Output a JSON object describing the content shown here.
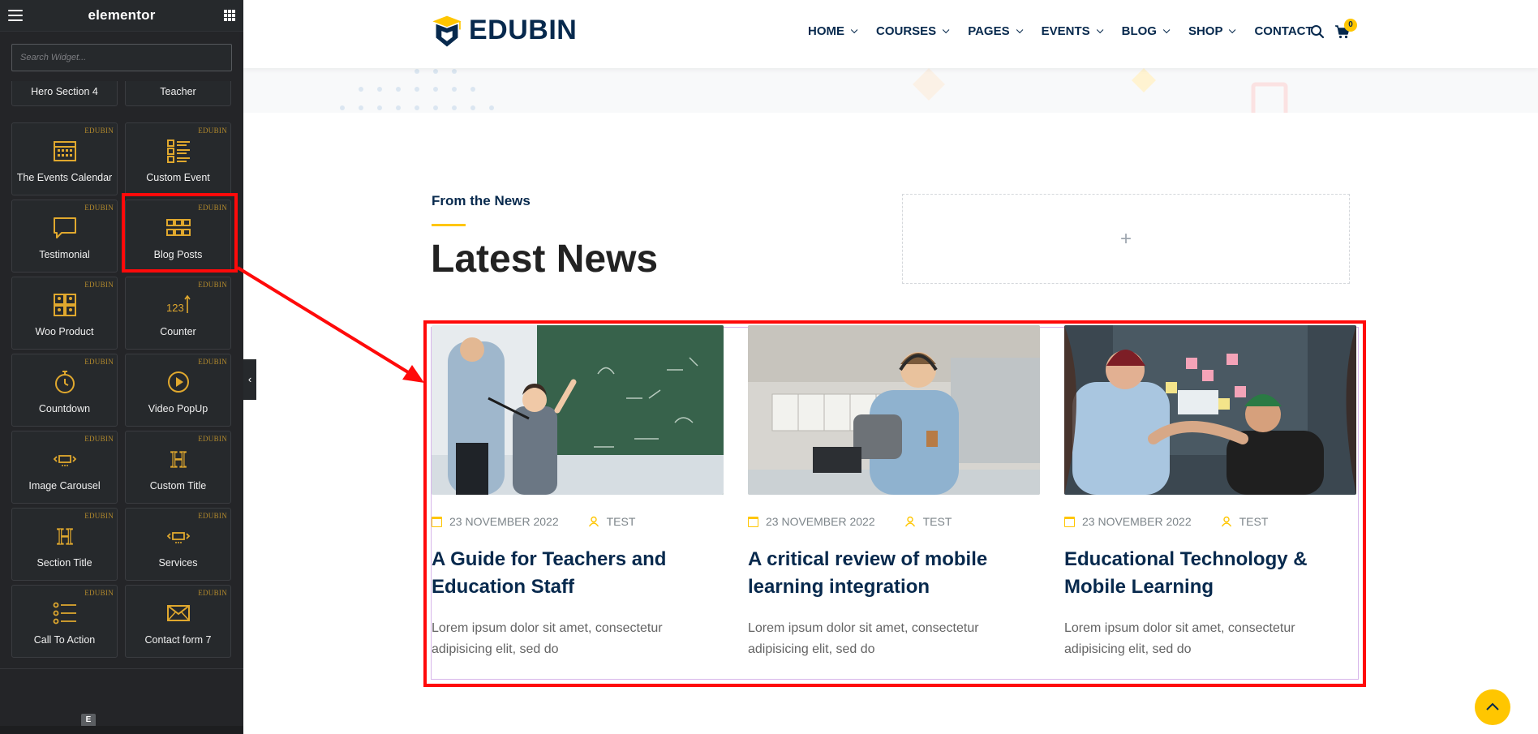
{
  "sidebar": {
    "title": "elementor",
    "search_placeholder": "Search Widget...",
    "badge": "EDUBIN",
    "partial_row": [
      "Hero Section 4",
      "Teacher"
    ],
    "widgets": [
      {
        "label": "The Events Calendar",
        "icon": "calendar-grid-icon"
      },
      {
        "label": "Custom Event",
        "icon": "list-icon"
      },
      {
        "label": "Testimonial",
        "icon": "speech-bubble-icon"
      },
      {
        "label": "Blog Posts",
        "icon": "posts-grid-icon"
      },
      {
        "label": "Woo Product",
        "icon": "product-grid-icon"
      },
      {
        "label": "Counter",
        "icon": "counter-icon",
        "icon_text": "123"
      },
      {
        "label": "Countdown",
        "icon": "stopwatch-icon"
      },
      {
        "label": "Video PopUp",
        "icon": "play-circle-icon"
      },
      {
        "label": "Image Carousel",
        "icon": "carousel-icon"
      },
      {
        "label": "Custom Title",
        "icon": "heading-icon",
        "icon_text": "H"
      },
      {
        "label": "Section Title",
        "icon": "heading-icon",
        "icon_text": "H"
      },
      {
        "label": "Services",
        "icon": "carousel-icon"
      },
      {
        "label": "Call To Action",
        "icon": "list-icon"
      },
      {
        "label": "Contact form 7",
        "icon": "envelope-icon"
      }
    ],
    "mini_logo": "E"
  },
  "header": {
    "logo_text": "EDUBIN",
    "nav": [
      {
        "label": "HOME",
        "dropdown": true
      },
      {
        "label": "COURSES",
        "dropdown": true
      },
      {
        "label": "PAGES",
        "dropdown": true
      },
      {
        "label": "EVENTS",
        "dropdown": true
      },
      {
        "label": "BLOG",
        "dropdown": true
      },
      {
        "label": "SHOP",
        "dropdown": true
      },
      {
        "label": "CONTACT",
        "dropdown": false
      }
    ],
    "cart_count": "0"
  },
  "section": {
    "subtitle": "From the News",
    "title": "Latest News",
    "empty_column": "+"
  },
  "posts": [
    {
      "date": "23 NOVEMBER 2022",
      "author": "TEST",
      "title": "A Guide for Teachers and Education Staff",
      "excerpt": "Lorem ipsum dolor sit amet, consectetur adipisicing elit, sed do"
    },
    {
      "date": "23 NOVEMBER 2022",
      "author": "TEST",
      "title": "A critical review of mobile learning integration",
      "excerpt": "Lorem ipsum dolor sit amet, consectetur adipisicing elit, sed do"
    },
    {
      "date": "23 NOVEMBER 2022",
      "author": "TEST",
      "title": "Educational Technology & Mobile Learning",
      "excerpt": "Lorem ipsum dolor sit amet, consectetur adipisicing elit, sed do"
    }
  ],
  "colors": {
    "brand_navy": "#07294d",
    "accent_yellow": "#ffc600",
    "sidebar_bg": "#242528",
    "highlight_red": "#ff0a0a"
  }
}
